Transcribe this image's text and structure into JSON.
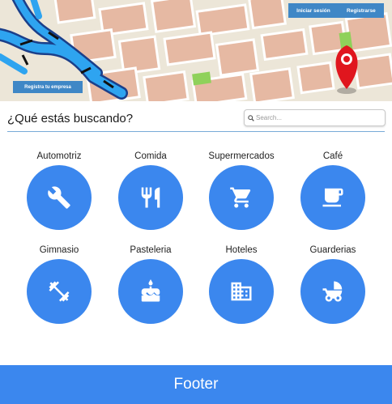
{
  "header": {
    "login_label": "Iniciar sesión",
    "signup_label": "Registrarse",
    "register_business_label": "Registra tu empresa"
  },
  "search": {
    "question": "¿Qué estás buscando?",
    "placeholder": "Search...",
    "value": ""
  },
  "categories": [
    {
      "label": "Automotriz",
      "icon": "wrench-icon"
    },
    {
      "label": "Comida",
      "icon": "utensils-icon"
    },
    {
      "label": "Supermercados",
      "icon": "shopping-cart-icon"
    },
    {
      "label": "Café",
      "icon": "coffee-cup-icon"
    },
    {
      "label": "Gimnasio",
      "icon": "dumbbell-icon"
    },
    {
      "label": "Pasteleria",
      "icon": "cake-icon"
    },
    {
      "label": "Hoteles",
      "icon": "hotel-building-icon"
    },
    {
      "label": "Guarderias",
      "icon": "baby-stroller-icon"
    }
  ],
  "footer": {
    "label": "Footer"
  },
  "colors": {
    "accent": "#3b87ee",
    "header_button": "#3f87c6",
    "map_pin": "#e0161e"
  }
}
